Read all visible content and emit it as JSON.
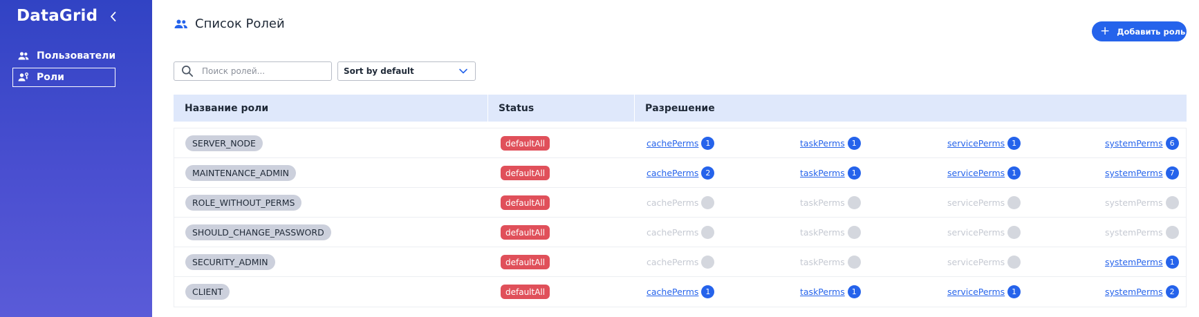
{
  "sidebar": {
    "brand": "DataGrid",
    "items": [
      {
        "label": "Пользователи",
        "icon": "users-icon"
      },
      {
        "label": "Роли",
        "icon": "user-key-icon",
        "active": true
      }
    ]
  },
  "header": {
    "title": "Список Ролей"
  },
  "toolbar": {
    "add_label": "Добавить роль",
    "search_placeholder": "Поиск ролей...",
    "sort_value": "Sort by default"
  },
  "table": {
    "columns": [
      "Название роли",
      "Status",
      "Разрешение"
    ],
    "perm_labels": [
      "cachePerms",
      "taskPerms",
      "servicePerms",
      "systemPerms"
    ],
    "rows": [
      {
        "name": "SERVER_NODE",
        "status": "defaultAll",
        "perms": [
          {
            "label": "cachePerms",
            "count": "1",
            "active": true
          },
          {
            "label": "taskPerms",
            "count": "1",
            "active": true
          },
          {
            "label": "servicePerms",
            "count": "1",
            "active": true
          },
          {
            "label": "systemPerms",
            "count": "6",
            "active": true
          }
        ]
      },
      {
        "name": "MAINTENANCE_ADMIN",
        "status": "defaultAll",
        "perms": [
          {
            "label": "cachePerms",
            "count": "2",
            "active": true
          },
          {
            "label": "taskPerms",
            "count": "1",
            "active": true
          },
          {
            "label": "servicePerms",
            "count": "1",
            "active": true
          },
          {
            "label": "systemPerms",
            "count": "7",
            "active": true
          }
        ]
      },
      {
        "name": "ROLE_WITHOUT_PERMS",
        "status": "defaultAll",
        "perms": [
          {
            "label": "cachePerms",
            "count": "",
            "active": false
          },
          {
            "label": "taskPerms",
            "count": "",
            "active": false
          },
          {
            "label": "servicePerms",
            "count": "",
            "active": false
          },
          {
            "label": "systemPerms",
            "count": "",
            "active": false
          }
        ]
      },
      {
        "name": "SHOULD_CHANGE_PASSWORD",
        "status": "defaultAll",
        "perms": [
          {
            "label": "cachePerms",
            "count": "",
            "active": false
          },
          {
            "label": "taskPerms",
            "count": "",
            "active": false
          },
          {
            "label": "servicePerms",
            "count": "",
            "active": false
          },
          {
            "label": "systemPerms",
            "count": "",
            "active": false
          }
        ]
      },
      {
        "name": "SECURITY_ADMIN",
        "status": "defaultAll",
        "perms": [
          {
            "label": "cachePerms",
            "count": "",
            "active": false
          },
          {
            "label": "taskPerms",
            "count": "",
            "active": false
          },
          {
            "label": "servicePerms",
            "count": "",
            "active": false
          },
          {
            "label": "systemPerms",
            "count": "1",
            "active": true
          }
        ]
      },
      {
        "name": "CLIENT",
        "status": "defaultAll",
        "perms": [
          {
            "label": "cachePerms",
            "count": "1",
            "active": true
          },
          {
            "label": "taskPerms",
            "count": "1",
            "active": true
          },
          {
            "label": "servicePerms",
            "count": "1",
            "active": true
          },
          {
            "label": "systemPerms",
            "count": "2",
            "active": true
          }
        ]
      }
    ]
  },
  "colors": {
    "accent": "#2563eb",
    "sidebar_top": "#3143c4",
    "sidebar_bottom": "#5a5bd8",
    "status_bg": "#e0505a",
    "header_bg": "#dfe8fb",
    "chip_bg": "#ccd0dc"
  }
}
